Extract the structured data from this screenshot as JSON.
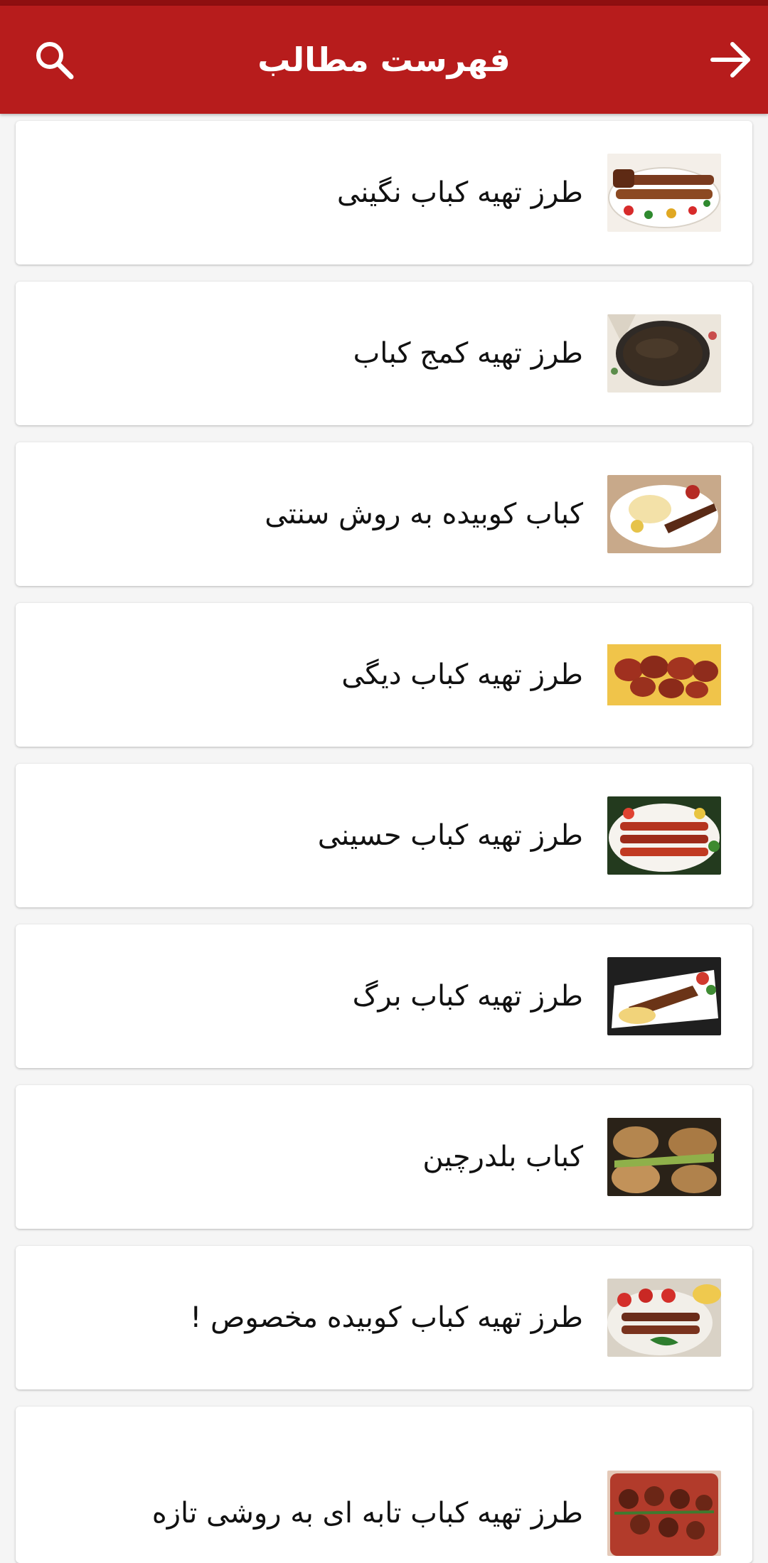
{
  "header": {
    "title": "فهرست مطالب",
    "search_icon": "search-icon",
    "back_icon": "arrow-right-icon"
  },
  "colors": {
    "primary": "#b71c1c",
    "primary_dark": "#8e0f10",
    "background": "#f5f5f5",
    "card": "#ffffff",
    "text": "#111111"
  },
  "items": [
    {
      "title": "طرز تهیه کباب نگینی",
      "thumb": "kebab-platter"
    },
    {
      "title": "طرز تهیه کمج کباب",
      "thumb": "stew-pot"
    },
    {
      "title": "کباب کوبیده به روش سنتی",
      "thumb": "kabob-rice-plate"
    },
    {
      "title": "طرز تهیه کباب دیگی",
      "thumb": "meatballs-fries"
    },
    {
      "title": "طرز تهیه کباب حسینی",
      "thumb": "skewer-platter"
    },
    {
      "title": "طرز تهیه کباب برگ",
      "thumb": "barg-kabob-plate"
    },
    {
      "title": "کباب بلدرچین",
      "thumb": "quail-kabob"
    },
    {
      "title": "طرز تهیه کباب کوبیده مخصوص !",
      "thumb": "koobideh-tomatoes"
    },
    {
      "title": "طرز تهیه کباب تابه ای به روشی تازه",
      "thumb": "pan-kabob"
    }
  ]
}
